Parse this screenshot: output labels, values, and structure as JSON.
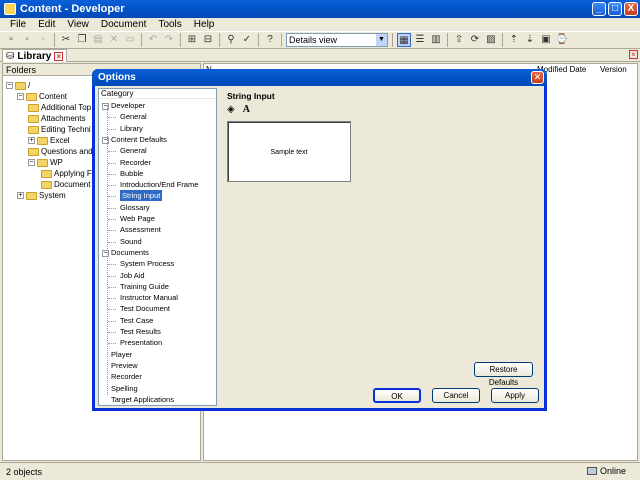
{
  "app": {
    "title": "Content - Developer",
    "window_controls": [
      "_",
      "□",
      "X"
    ]
  },
  "menu": [
    "File",
    "Edit",
    "View",
    "Document",
    "Tools",
    "Help"
  ],
  "toolbar": {
    "view_select": "Details view"
  },
  "library_tab": {
    "label": "Library"
  },
  "folders": {
    "header": "Folders",
    "items": [
      {
        "label": "/",
        "indent": 0,
        "expander": "−"
      },
      {
        "label": "Content",
        "indent": 1,
        "expander": "−"
      },
      {
        "label": "Additional Top",
        "indent": 2,
        "expander": ""
      },
      {
        "label": "Attachments",
        "indent": 2,
        "expander": ""
      },
      {
        "label": "Editing Techni",
        "indent": 2,
        "expander": ""
      },
      {
        "label": "Excel",
        "indent": 2,
        "expander": "+"
      },
      {
        "label": "Questions and",
        "indent": 2,
        "expander": ""
      },
      {
        "label": "WP",
        "indent": 2,
        "expander": "−"
      },
      {
        "label": "Applying F",
        "indent": 3,
        "expander": ""
      },
      {
        "label": "Document",
        "indent": 3,
        "expander": ""
      },
      {
        "label": "System",
        "indent": 1,
        "expander": "+"
      }
    ]
  },
  "list": {
    "columns": [
      "N",
      "Modified Date",
      "Version"
    ]
  },
  "status": {
    "count": "2 objects",
    "mode": "Online"
  },
  "dialog": {
    "title": "Options",
    "category_header": "Category",
    "categories": [
      {
        "label": "Developer",
        "level": 0,
        "expander": "−"
      },
      {
        "label": "General",
        "level": 1,
        "expander": ""
      },
      {
        "label": "Library",
        "level": 1,
        "expander": ""
      },
      {
        "label": "Content Defaults",
        "level": 0,
        "expander": "−"
      },
      {
        "label": "General",
        "level": 1,
        "expander": ""
      },
      {
        "label": "Recorder",
        "level": 1,
        "expander": ""
      },
      {
        "label": "Bubble",
        "level": 1,
        "expander": ""
      },
      {
        "label": "Introduction/End Frame",
        "level": 1,
        "expander": ""
      },
      {
        "label": "String Input",
        "level": 1,
        "expander": "",
        "selected": true
      },
      {
        "label": "Glossary",
        "level": 1,
        "expander": ""
      },
      {
        "label": "Web Page",
        "level": 1,
        "expander": ""
      },
      {
        "label": "Assessment",
        "level": 1,
        "expander": ""
      },
      {
        "label": "Sound",
        "level": 1,
        "expander": ""
      },
      {
        "label": "Documents",
        "level": 0,
        "expander": "−"
      },
      {
        "label": "System Process",
        "level": 1,
        "expander": ""
      },
      {
        "label": "Job Aid",
        "level": 1,
        "expander": ""
      },
      {
        "label": "Training Guide",
        "level": 1,
        "expander": ""
      },
      {
        "label": "Instructor Manual",
        "level": 1,
        "expander": ""
      },
      {
        "label": "Test Document",
        "level": 1,
        "expander": ""
      },
      {
        "label": "Test Case",
        "level": 1,
        "expander": ""
      },
      {
        "label": "Test Results",
        "level": 1,
        "expander": ""
      },
      {
        "label": "Presentation",
        "level": 1,
        "expander": ""
      },
      {
        "label": "Player",
        "level": 0,
        "expander": ""
      },
      {
        "label": "Preview",
        "level": 0,
        "expander": ""
      },
      {
        "label": "Recorder",
        "level": 0,
        "expander": ""
      },
      {
        "label": "Spelling",
        "level": 0,
        "expander": ""
      },
      {
        "label": "Target Applications",
        "level": 0,
        "expander": ""
      }
    ],
    "section_title": "String Input",
    "font_glyph": "A",
    "sample_text": "Sample text",
    "restore_defaults": "Restore Defaults",
    "ok": "OK",
    "cancel": "Cancel",
    "apply": "Apply"
  }
}
